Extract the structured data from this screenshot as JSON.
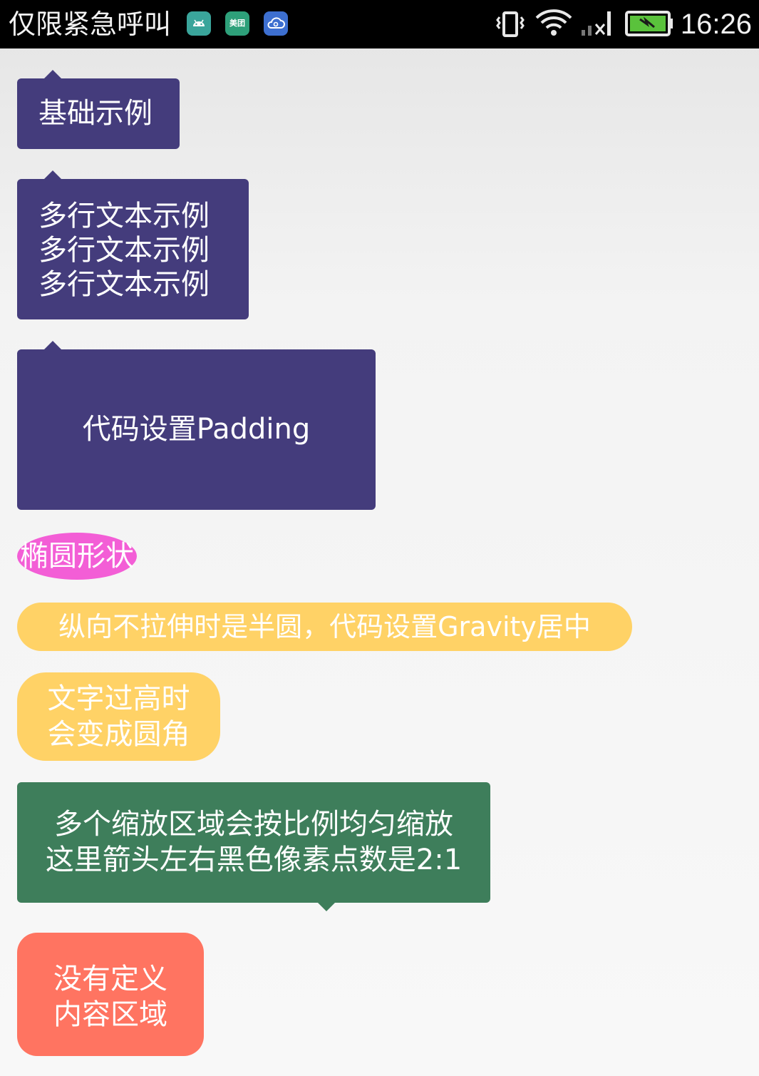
{
  "status_bar": {
    "carrier_text": "仅限紧急呼叫",
    "clock": "16:26",
    "notification_icons": [
      "android-icon",
      "meituan-icon",
      "cloud-icon"
    ],
    "meituan_label": "美团",
    "system_icons": [
      "vibrate-icon",
      "wifi-icon",
      "signal-no-sim-icon",
      "battery-charging-icon"
    ],
    "battery_level": 1.0
  },
  "bubbles": {
    "basic": {
      "text": "基础示例",
      "color": "#443c7c",
      "arrow": "top-left"
    },
    "multiline": {
      "text": "多行文本示例\n多行文本示例\n多行文本示例",
      "color": "#443c7c",
      "arrow": "top-left"
    },
    "padding": {
      "text": "代码设置Padding",
      "color": "#443c7c",
      "arrow": "top-left"
    },
    "ellipse": {
      "text": "椭圆形状",
      "color": "#f35ed6"
    },
    "gravity": {
      "text": "纵向不拉伸时是半圆，代码设置Gravity居中",
      "color": "#ffd266"
    },
    "tall": {
      "text": "文字过高时\n会变成圆角",
      "color": "#ffd266"
    },
    "scale": {
      "text": "多个缩放区域会按比例均匀缩放\n这里箭头左右黑色像素点数是2:1",
      "color": "#3e7e5b",
      "arrow": "bottom"
    },
    "no_content": {
      "text": "没有定义\n内容区域",
      "color": "#ff7461"
    }
  }
}
